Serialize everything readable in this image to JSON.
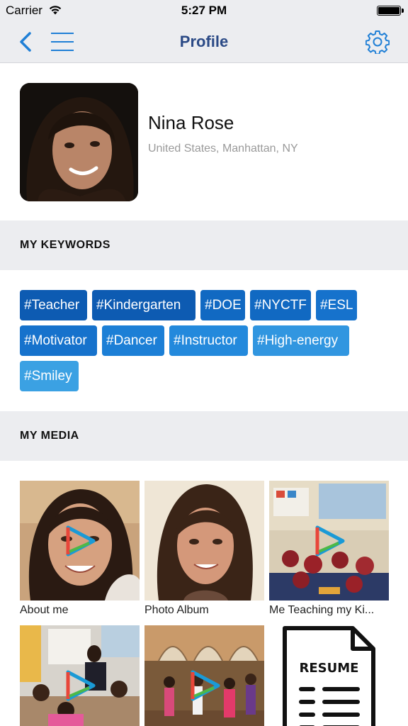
{
  "status_bar": {
    "carrier": "Carrier",
    "time": "5:27 PM",
    "icons": [
      "wifi-icon",
      "battery-icon"
    ]
  },
  "nav": {
    "title": "Profile",
    "icons": [
      "back-chevron-icon",
      "hamburger-menu-icon",
      "gear-icon"
    ],
    "accent_color": "#1f7fd6",
    "title_color": "#2b4a86"
  },
  "profile": {
    "name": "Nina Rose",
    "location": "United States, Manhattan, NY"
  },
  "keywords_section": {
    "header": "MY KEYWORDS",
    "tags": [
      {
        "label": "#Teacher",
        "color": "#0d5bb2"
      },
      {
        "label": "#Kindergarten",
        "color": "#0d5bb2"
      },
      {
        "label": "#DOE",
        "color": "#1169c2"
      },
      {
        "label": "#NYCTF",
        "color": "#1169c2"
      },
      {
        "label": "#ESL",
        "color": "#1672cc"
      },
      {
        "label": "#Motivator",
        "color": "#1672cc"
      },
      {
        "label": "#Dancer",
        "color": "#1c7fd6"
      },
      {
        "label": "#Instructor",
        "color": "#2389dc"
      },
      {
        "label": "#High-energy",
        "color": "#3196e0"
      },
      {
        "label": "#Smiley",
        "color": "#3ba1e3"
      }
    ]
  },
  "media_section": {
    "header": "MY MEDIA",
    "items": [
      {
        "caption": "About me",
        "type": "video"
      },
      {
        "caption": "Photo Album",
        "type": "photo"
      },
      {
        "caption": "Me Teaching my Ki...",
        "type": "video"
      },
      {
        "caption": "",
        "type": "video"
      },
      {
        "caption": "",
        "type": "video"
      },
      {
        "caption": "RESUME",
        "type": "document"
      }
    ]
  }
}
